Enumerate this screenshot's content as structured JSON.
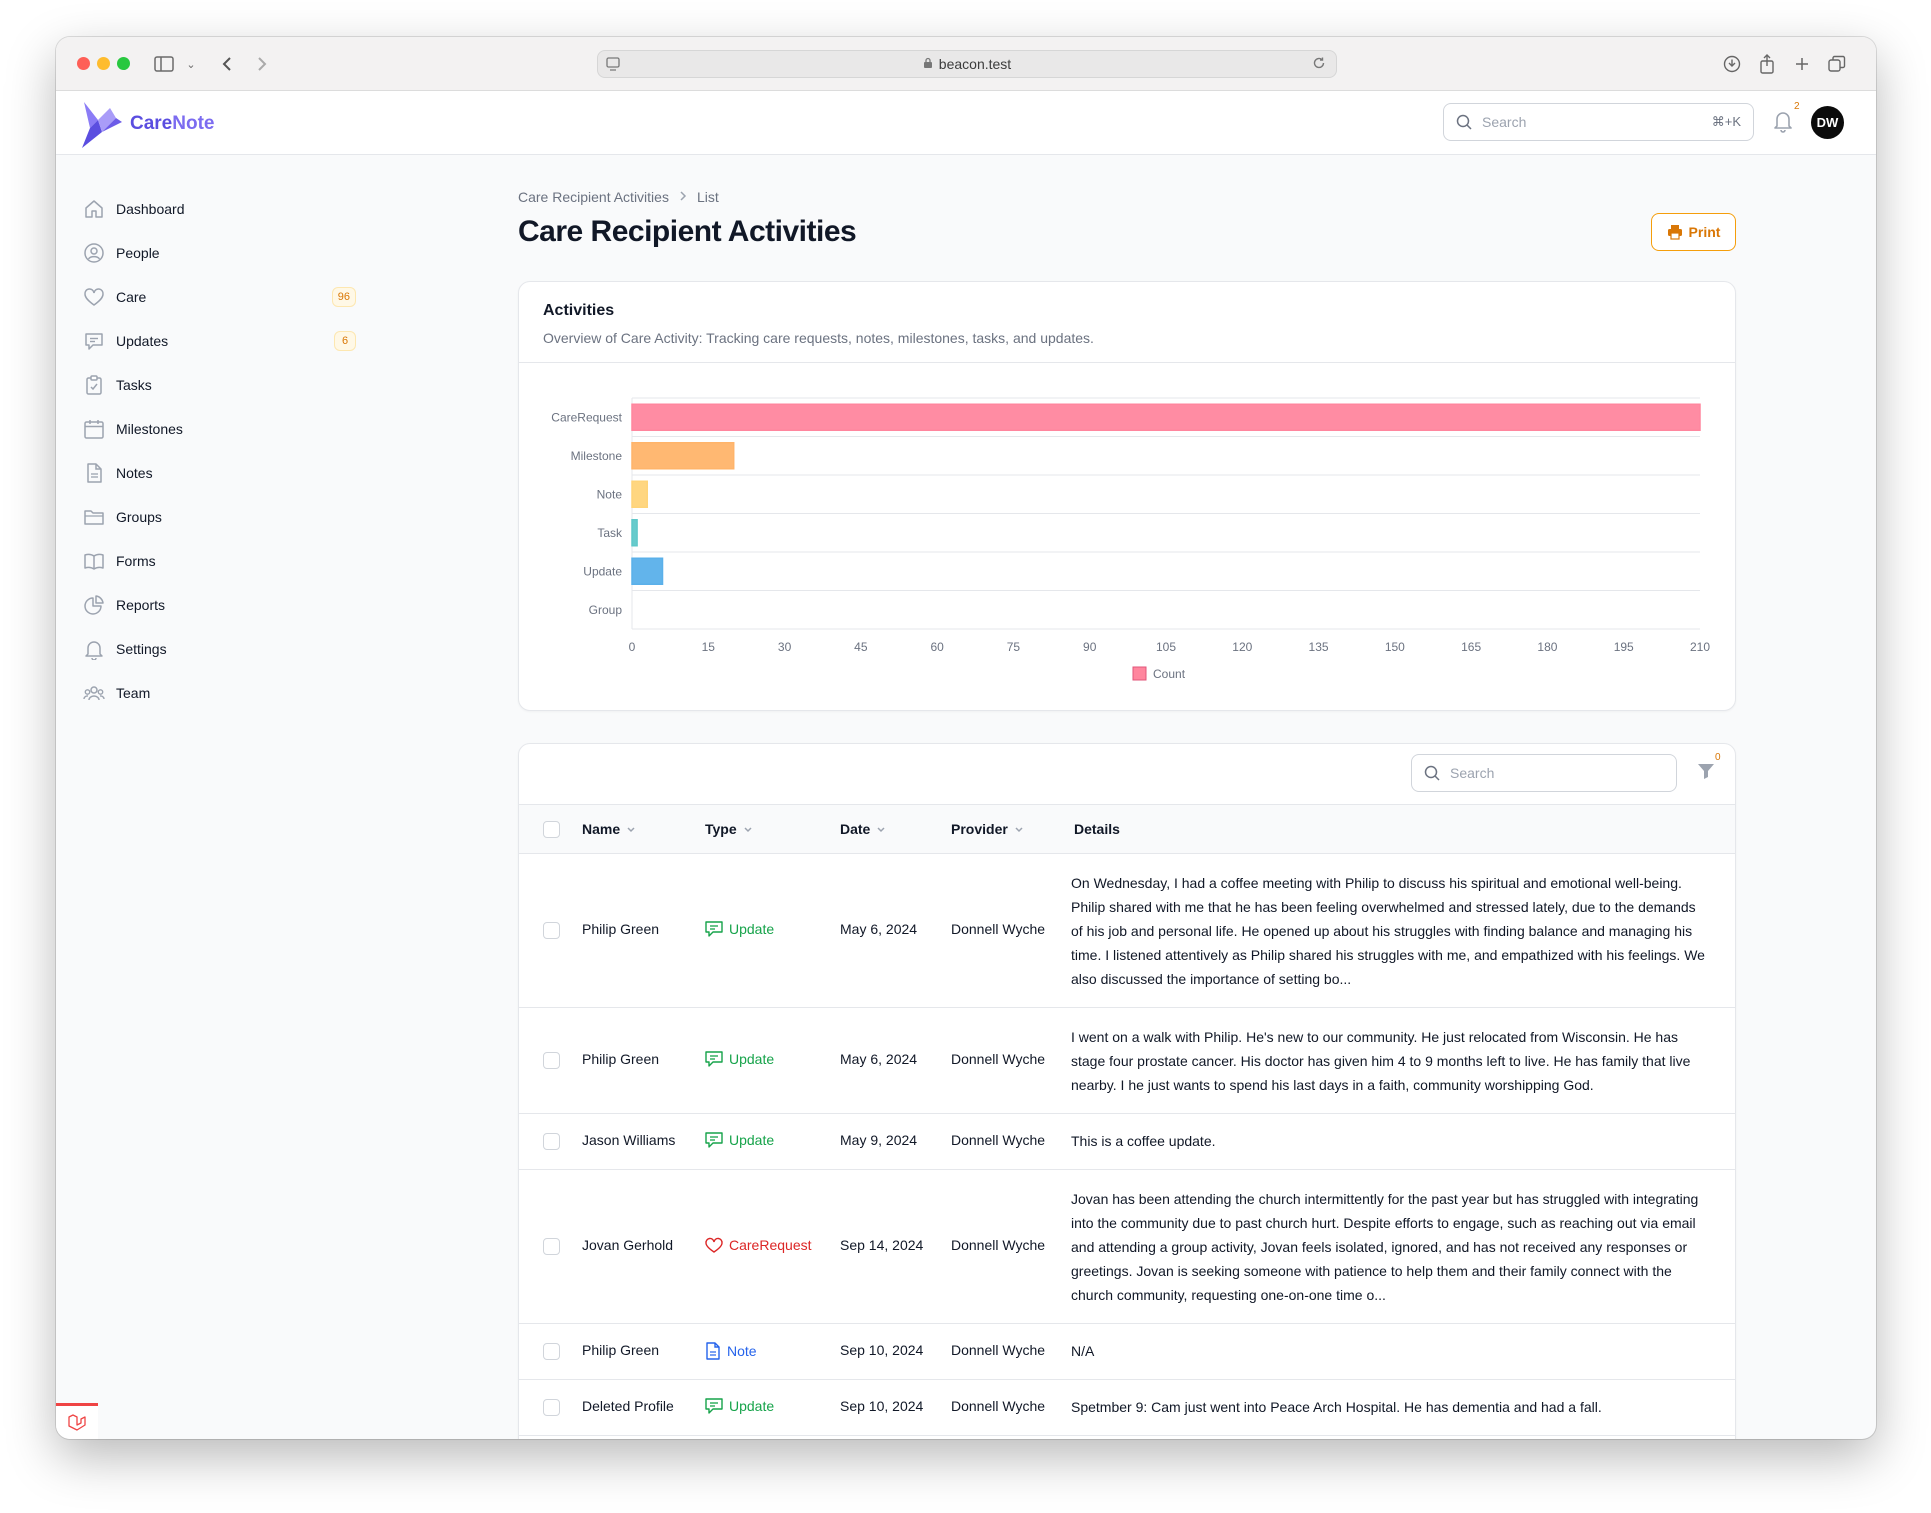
{
  "browser": {
    "url": "beacon.test"
  },
  "app": {
    "logo_prefix": "Care",
    "logo_suffix": "Note",
    "search_placeholder": "Search",
    "search_shortcut": "⌘+K",
    "notification_count": "2",
    "avatar_initials": "DW"
  },
  "sidebar": {
    "items": [
      {
        "label": "Dashboard",
        "icon": "home-icon"
      },
      {
        "label": "People",
        "icon": "user-circle-icon"
      },
      {
        "label": "Care",
        "icon": "heart-icon",
        "badge": "96"
      },
      {
        "label": "Updates",
        "icon": "chat-icon",
        "badge": "6"
      },
      {
        "label": "Tasks",
        "icon": "clipboard-check-icon"
      },
      {
        "label": "Milestones",
        "icon": "calendar-icon"
      },
      {
        "label": "Notes",
        "icon": "document-icon"
      },
      {
        "label": "Groups",
        "icon": "folder-icon"
      },
      {
        "label": "Forms",
        "icon": "book-open-icon"
      },
      {
        "label": "Reports",
        "icon": "chart-pie-icon"
      },
      {
        "label": "Settings",
        "icon": "bell-icon"
      },
      {
        "label": "Team",
        "icon": "user-group-icon"
      }
    ]
  },
  "page": {
    "breadcrumb": [
      "Care Recipient Activities",
      "List"
    ],
    "title": "Care Recipient Activities",
    "print_label": "Print"
  },
  "activities_card": {
    "title": "Activities",
    "subtitle": "Overview of Care Activity: Tracking care requests, notes, milestones, tasks, and updates."
  },
  "chart_data": {
    "type": "bar",
    "orientation": "horizontal",
    "categories": [
      "CareRequest",
      "Milestone",
      "Note",
      "Task",
      "Update",
      "Group"
    ],
    "series": [
      {
        "name": "Count",
        "values": [
          210,
          20,
          3,
          1,
          6,
          0
        ]
      }
    ],
    "bar_colors": [
      "#ff869e",
      "#ffb46a",
      "#ffd479",
      "#5fc8c9",
      "#5ab0ea",
      "#b0b0b0"
    ],
    "xlim": [
      0,
      210
    ],
    "xticks": [
      0,
      15,
      30,
      45,
      60,
      75,
      90,
      105,
      120,
      135,
      150,
      165,
      180,
      195,
      210
    ],
    "legend": "bottom",
    "grid": true
  },
  "table": {
    "search_placeholder": "Search",
    "filter_count": "0",
    "columns": [
      "Name",
      "Type",
      "Date",
      "Provider",
      "Details"
    ],
    "rows": [
      {
        "name": "Philip Green",
        "type": "Update",
        "date": "May 6, 2024",
        "provider": "Donnell Wyche",
        "details": "On Wednesday, I had a coffee meeting with Philip to discuss his spiritual and emotional well-being. Philip shared with me that he has been feeling overwhelmed and stressed lately, due to the demands of his job and personal life. He opened up about his struggles with finding balance and managing his time. I listened attentively as Philip shared his struggles with me, and empathized with his feelings. We also discussed the importance of setting bo..."
      },
      {
        "name": "Philip Green",
        "type": "Update",
        "date": "May 6, 2024",
        "provider": "Donnell Wyche",
        "details": "I went on a walk with Philip. He's new to our community. He just relocated from Wisconsin. He has stage four prostate cancer. His doctor has given him 4 to 9 months left to live. He has family that live nearby. I he just wants to spend his last days in a faith, community worshipping God."
      },
      {
        "name": "Jason Williams",
        "type": "Update",
        "date": "May 9, 2024",
        "provider": "Donnell Wyche",
        "details": "This is a coffee update."
      },
      {
        "name": "Jovan Gerhold",
        "type": "CareRequest",
        "date": "Sep 14, 2024",
        "provider": "Donnell Wyche",
        "details": "Jovan has been attending the church intermittently for the past year but has struggled with integrating into the community due to past church hurt. Despite efforts to engage, such as reaching out via email and attending a group activity, Jovan feels isolated, ignored, and has not received any responses or greetings. Jovan is seeking someone with patience to help them and their family connect with the church community, requesting one-on-one time o..."
      },
      {
        "name": "Philip Green",
        "type": "Note",
        "date": "Sep 10, 2024",
        "provider": "Donnell Wyche",
        "details": "N/A"
      },
      {
        "name": "Deleted Profile",
        "type": "Update",
        "date": "Sep 10, 2024",
        "provider": "Donnell Wyche",
        "details": "Spetmber 9: Cam just went into Peace Arch Hospital. He has dementia and had a fall."
      }
    ]
  },
  "colors": {
    "accent": "#d97706",
    "brand": "#6d5ce8",
    "update": "#16a34a",
    "care_request": "#dc2626",
    "note": "#2563eb"
  }
}
